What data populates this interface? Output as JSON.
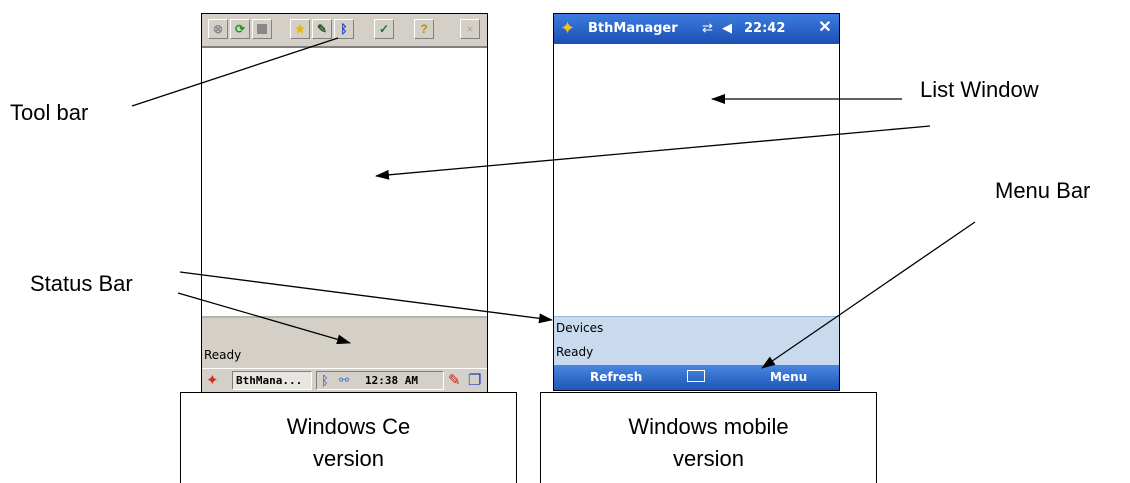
{
  "callouts": {
    "tool_bar": "Tool bar",
    "list_window": "List Window",
    "menu_bar": "Menu Bar",
    "status_bar": "Status Bar"
  },
  "ce_device": {
    "status_text": "Ready",
    "taskbar_app": "BthMana...",
    "clock": "12:38 AM",
    "toolbar_buttons": [
      "stop-icon",
      "refresh-icon",
      "blank-icon",
      "star-icon",
      "pen-icon",
      "bluetooth-icon",
      "check-icon",
      "help-icon",
      "close-icon"
    ]
  },
  "wm_device": {
    "title": "BthManager",
    "time": "22:42",
    "status_line_1": "Devices",
    "status_line_2": "Ready",
    "left_softkey": "Refresh",
    "right_softkey": "Menu"
  },
  "version_labels": {
    "ce_line1": "Windows Ce",
    "ce_line2": "version",
    "wm_line1": "Windows mobile",
    "wm_line2": "version"
  }
}
